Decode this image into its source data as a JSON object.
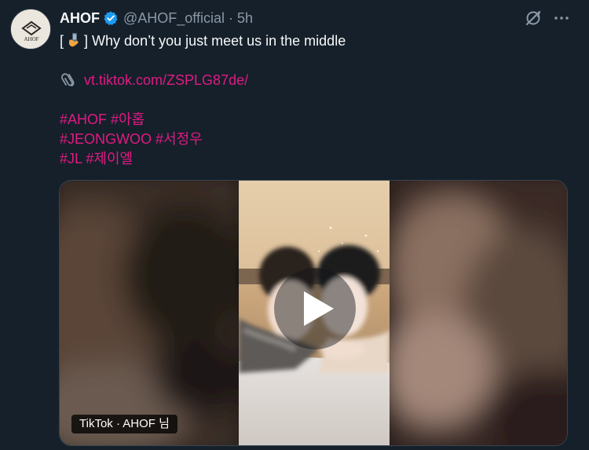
{
  "tweet": {
    "display_name": "AHOF",
    "handle": "@AHOF_official",
    "separator": "·",
    "time": "5h",
    "avatar_text": "AHOF",
    "text_line1_prefix": "[",
    "text_line1_emoji": "phone-in-hand",
    "text_line1_suffix": "] Why don’t you just meet us in the middle",
    "link_icon": "paperclip-icon",
    "link_text": "vt.tiktok.com/ZSPLG87de/",
    "hashtags": [
      [
        "#AHOF",
        "#아홉"
      ],
      [
        "#JEONGWOO",
        "#서정우"
      ],
      [
        "#JL",
        "#제이엘"
      ]
    ]
  },
  "media": {
    "caption": "TikTok · AHOF 님",
    "play_icon": "play-icon"
  },
  "colors": {
    "background": "#15202b",
    "text": "#f7f9f9",
    "secondary": "#8b98a5",
    "link": "#e11a82",
    "verified": "#1d9bf0"
  },
  "icons": [
    "grok-icon",
    "more-icon",
    "verified-badge-icon"
  ]
}
